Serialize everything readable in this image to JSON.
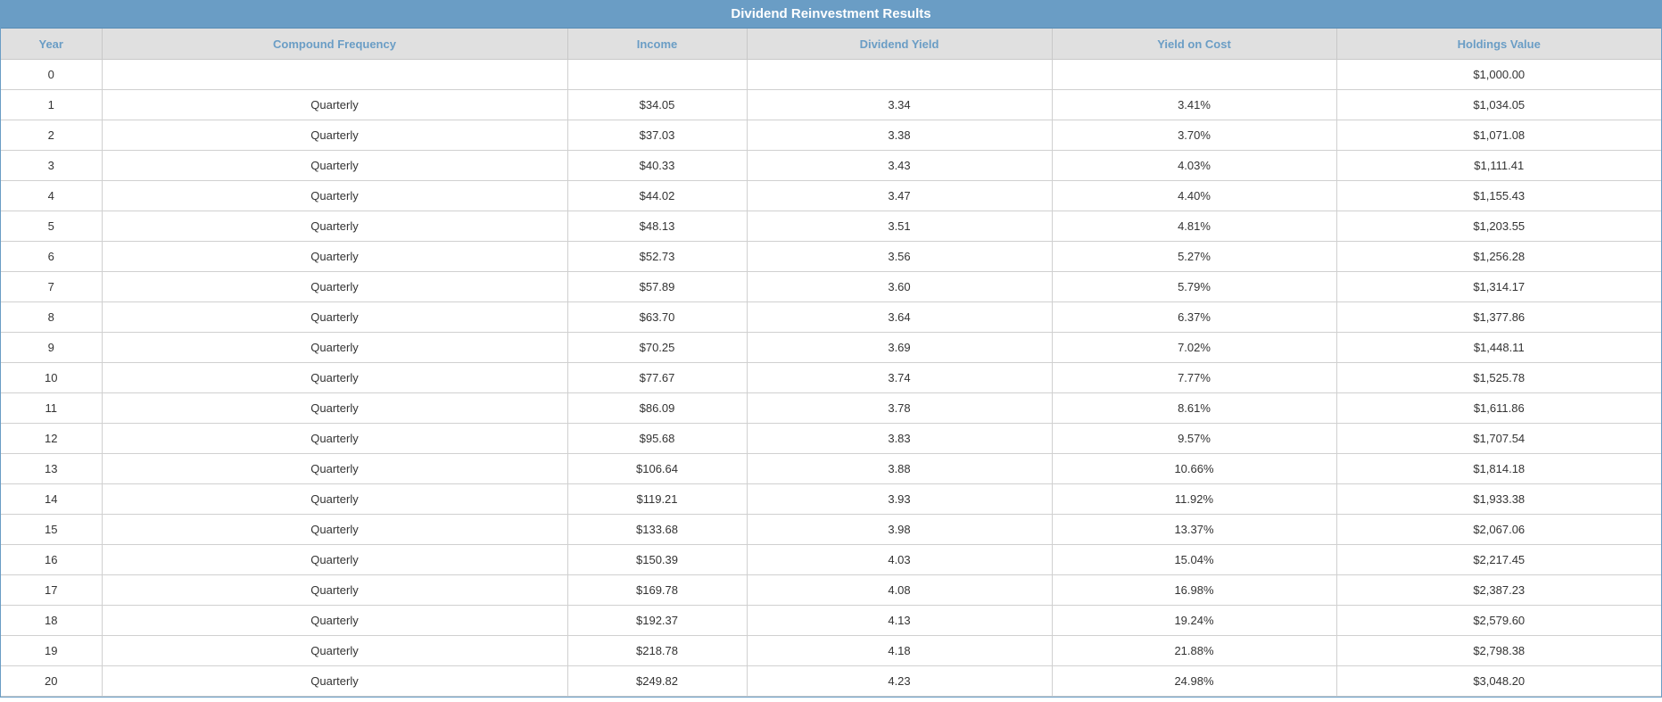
{
  "title": "Dividend Reinvestment Results",
  "colors": {
    "title_bg": "#6a9dc5",
    "header_bg": "#e0e0e0",
    "header_text": "#6a9dc5"
  },
  "columns": [
    "Year",
    "Compound Frequency",
    "Income",
    "Dividend Yield",
    "Yield on Cost",
    "Holdings Value"
  ],
  "rows": [
    [
      "0",
      "",
      "",
      "",
      "",
      "$1,000.00"
    ],
    [
      "1",
      "Quarterly",
      "$34.05",
      "3.34",
      "3.41%",
      "$1,034.05"
    ],
    [
      "2",
      "Quarterly",
      "$37.03",
      "3.38",
      "3.70%",
      "$1,071.08"
    ],
    [
      "3",
      "Quarterly",
      "$40.33",
      "3.43",
      "4.03%",
      "$1,111.41"
    ],
    [
      "4",
      "Quarterly",
      "$44.02",
      "3.47",
      "4.40%",
      "$1,155.43"
    ],
    [
      "5",
      "Quarterly",
      "$48.13",
      "3.51",
      "4.81%",
      "$1,203.55"
    ],
    [
      "6",
      "Quarterly",
      "$52.73",
      "3.56",
      "5.27%",
      "$1,256.28"
    ],
    [
      "7",
      "Quarterly",
      "$57.89",
      "3.60",
      "5.79%",
      "$1,314.17"
    ],
    [
      "8",
      "Quarterly",
      "$63.70",
      "3.64",
      "6.37%",
      "$1,377.86"
    ],
    [
      "9",
      "Quarterly",
      "$70.25",
      "3.69",
      "7.02%",
      "$1,448.11"
    ],
    [
      "10",
      "Quarterly",
      "$77.67",
      "3.74",
      "7.77%",
      "$1,525.78"
    ],
    [
      "11",
      "Quarterly",
      "$86.09",
      "3.78",
      "8.61%",
      "$1,611.86"
    ],
    [
      "12",
      "Quarterly",
      "$95.68",
      "3.83",
      "9.57%",
      "$1,707.54"
    ],
    [
      "13",
      "Quarterly",
      "$106.64",
      "3.88",
      "10.66%",
      "$1,814.18"
    ],
    [
      "14",
      "Quarterly",
      "$119.21",
      "3.93",
      "11.92%",
      "$1,933.38"
    ],
    [
      "15",
      "Quarterly",
      "$133.68",
      "3.98",
      "13.37%",
      "$2,067.06"
    ],
    [
      "16",
      "Quarterly",
      "$150.39",
      "4.03",
      "15.04%",
      "$2,217.45"
    ],
    [
      "17",
      "Quarterly",
      "$169.78",
      "4.08",
      "16.98%",
      "$2,387.23"
    ],
    [
      "18",
      "Quarterly",
      "$192.37",
      "4.13",
      "19.24%",
      "$2,579.60"
    ],
    [
      "19",
      "Quarterly",
      "$218.78",
      "4.18",
      "21.88%",
      "$2,798.38"
    ],
    [
      "20",
      "Quarterly",
      "$249.82",
      "4.23",
      "24.98%",
      "$3,048.20"
    ]
  ]
}
